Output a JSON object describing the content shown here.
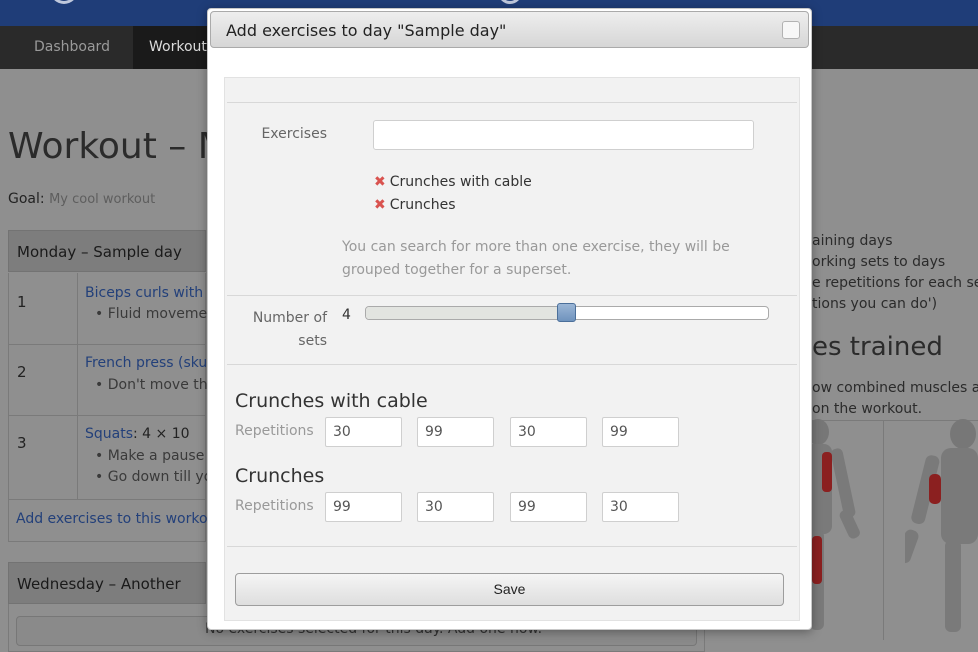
{
  "background": {
    "nav": {
      "items": [
        "Dashboard",
        "Workout"
      ]
    },
    "page_title": "Workout – M",
    "goal": {
      "label": "Goal:",
      "value": "My cool workout"
    },
    "day1": {
      "header": "Monday – Sample day",
      "rows": [
        {
          "num": "1",
          "link": "Biceps curls with du",
          "notes": [
            "Fluid movemen"
          ]
        },
        {
          "num": "2",
          "link": "French press (skull",
          "notes": [
            "Don't move the"
          ]
        },
        {
          "num": "3",
          "link": "Squats",
          "suffix": ": 4 × 10",
          "notes": [
            "Make a pause a",
            "Go down till you"
          ]
        }
      ],
      "add_link": "Add exercises to this workout"
    },
    "day2": {
      "header": "Wednesday – Another sam",
      "empty_text": "No exercises selected for this day. Add one now."
    },
    "right": {
      "lines": [
        "aining days",
        "orking sets to days",
        "e repetitions for each set (",
        "tions you can do')"
      ],
      "heading": "es trained",
      "lines2": [
        "ow combined muscles as t",
        "on the workout."
      ]
    }
  },
  "modal": {
    "title": "Add exercises to day \"Sample day\"",
    "exercises_label": "Exercises",
    "search_value": "",
    "selected_exercises": [
      "Crunches with cable",
      "Crunches"
    ],
    "hint": "You can search for more than one exercise, they will be grouped together for a superset.",
    "sets_label": "Number of sets",
    "sets_value": "4",
    "sets_fraction": 0.5,
    "blocks": [
      {
        "title": "Crunches with cable",
        "reps_label": "Repetitions",
        "reps": [
          "30",
          "99",
          "30",
          "99"
        ]
      },
      {
        "title": "Crunches",
        "reps_label": "Repetitions",
        "reps": [
          "99",
          "30",
          "99",
          "30"
        ]
      }
    ],
    "save_label": "Save"
  }
}
